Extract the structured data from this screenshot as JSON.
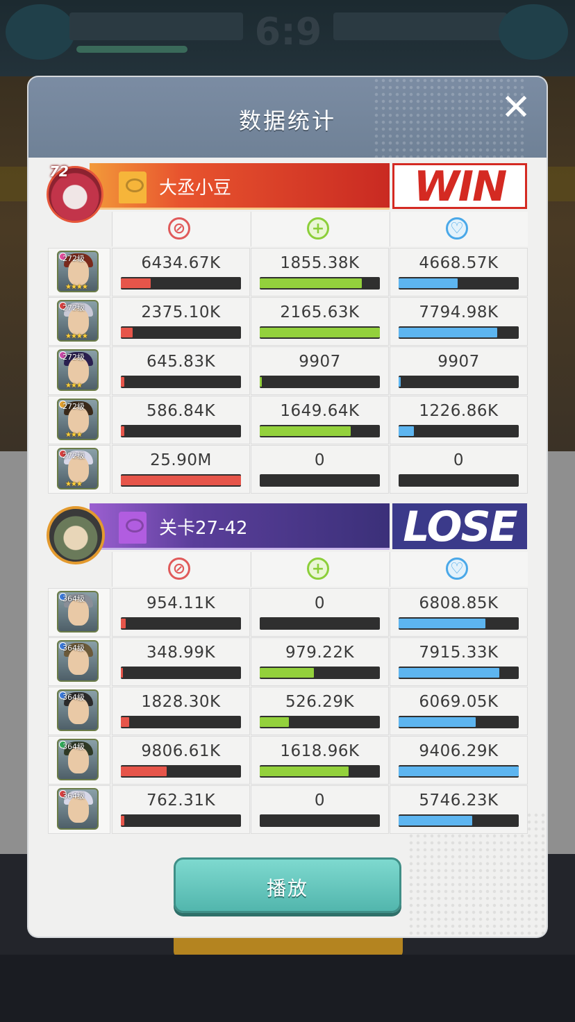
{
  "dialog": {
    "title": "数据统计",
    "play_label": "播放"
  },
  "colors": {
    "damage": "#e6554a",
    "heal": "#93d13c",
    "shield": "#5db5f0",
    "win": "#d42a22",
    "lose": "#3b3a8a"
  },
  "stat_icons": [
    "sword-icon",
    "heal-cross-icon",
    "shield-icon"
  ],
  "teams": [
    {
      "name": "大丞小豆",
      "level": "72",
      "result": "WIN",
      "heroes": [
        {
          "level": "272级",
          "stars": "★★★★",
          "damage": "6434.67K",
          "heal": "1855.38K",
          "shield": "4668.57K",
          "damage_pct": 0.25,
          "heal_pct": 0.85,
          "shield_pct": 0.49
        },
        {
          "level": "272级",
          "stars": "★★★★",
          "damage": "2375.10K",
          "heal": "2165.63K",
          "shield": "7794.98K",
          "damage_pct": 0.1,
          "heal_pct": 1.0,
          "shield_pct": 0.82
        },
        {
          "level": "272级",
          "stars": "★★★",
          "damage": "645.83K",
          "heal": "9907",
          "shield": "9907",
          "damage_pct": 0.03,
          "heal_pct": 0.01,
          "shield_pct": 0.01
        },
        {
          "level": "272级",
          "stars": "★★★",
          "damage": "586.84K",
          "heal": "1649.64K",
          "shield": "1226.86K",
          "damage_pct": 0.03,
          "heal_pct": 0.76,
          "shield_pct": 0.13
        },
        {
          "level": "272级",
          "stars": "★★★",
          "damage": "25.90M",
          "heal": "0",
          "shield": "0",
          "damage_pct": 1.0,
          "heal_pct": 0,
          "shield_pct": 0
        }
      ]
    },
    {
      "name": "关卡27-42",
      "level": "",
      "result": "LOSE",
      "heroes": [
        {
          "level": "364级",
          "stars": "",
          "damage": "954.11K",
          "heal": "0",
          "shield": "6808.85K",
          "damage_pct": 0.04,
          "heal_pct": 0,
          "shield_pct": 0.72
        },
        {
          "level": "364级",
          "stars": "",
          "damage": "348.99K",
          "heal": "979.22K",
          "shield": "7915.33K",
          "damage_pct": 0.01,
          "heal_pct": 0.45,
          "shield_pct": 0.84
        },
        {
          "level": "364级",
          "stars": "",
          "damage": "1828.30K",
          "heal": "526.29K",
          "shield": "6069.05K",
          "damage_pct": 0.07,
          "heal_pct": 0.24,
          "shield_pct": 0.64
        },
        {
          "level": "364级",
          "stars": "",
          "damage": "9806.61K",
          "heal": "1618.96K",
          "shield": "9406.29K",
          "damage_pct": 0.38,
          "heal_pct": 0.74,
          "shield_pct": 1.0
        },
        {
          "level": "364级",
          "stars": "",
          "damage": "762.31K",
          "heal": "0",
          "shield": "5746.23K",
          "damage_pct": 0.03,
          "heal_pct": 0,
          "shield_pct": 0.61
        }
      ]
    }
  ]
}
